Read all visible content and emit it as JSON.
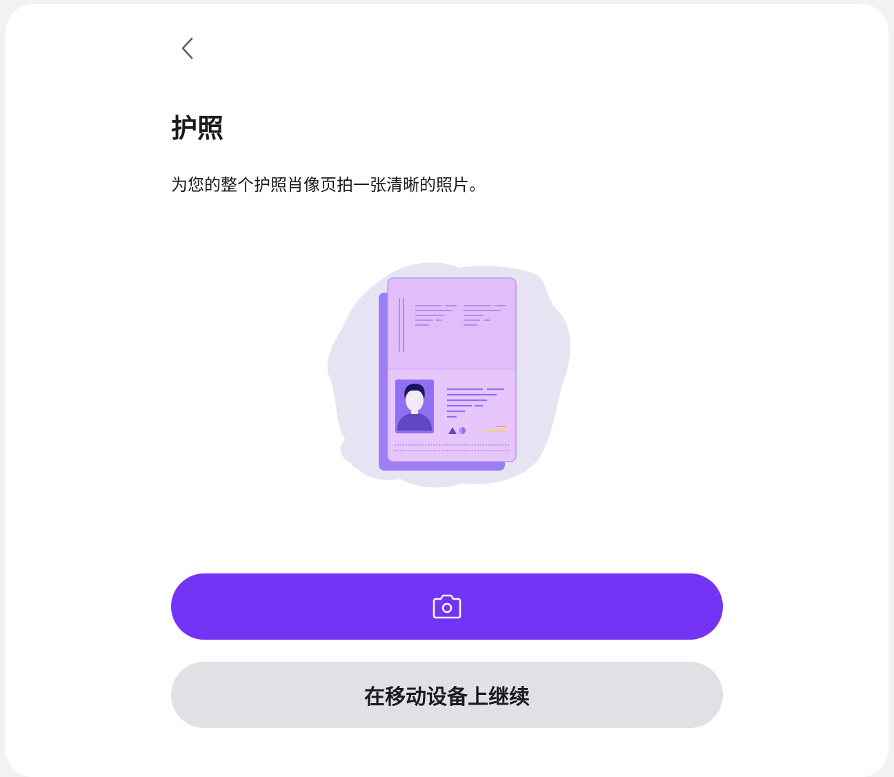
{
  "header": {
    "back_icon": "chevron-left-icon"
  },
  "content": {
    "title": "护照",
    "description": "为您的整个护照肖像页拍一张清晰的照片。",
    "illustration": "passport-illustration"
  },
  "actions": {
    "take_photo_icon": "camera-icon",
    "continue_on_mobile_label": "在移动设备上继续"
  },
  "colors": {
    "primary": "#7433f5",
    "secondary_bg": "#e0e0e5",
    "text": "#1a1a1f",
    "passport_light": "#e8c3fb",
    "passport_dark": "#9a7cf6"
  }
}
